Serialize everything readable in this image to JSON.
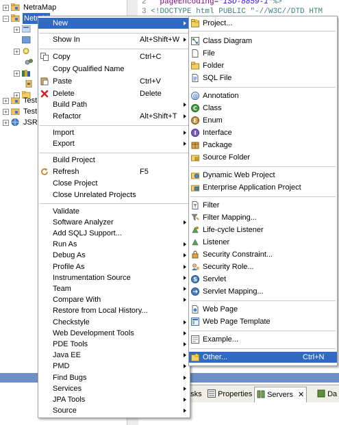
{
  "tree": {
    "items": [
      {
        "label": "NetraMap"
      },
      {
        "label": "NetraM"
      },
      {
        "label": "Test"
      },
      {
        "label": "Test"
      },
      {
        "label": "JSR"
      }
    ]
  },
  "editor": {
    "line2_num": "2",
    "line2_attr": "pageEncoding",
    "line2_eq": "=",
    "line2_str": "\"ISO-8859-1\"",
    "line2_end": "%>",
    "line3_num": "3",
    "line3_text": "<!DOCTYPE html PUBLIC \"-//W3C//DTD HTM"
  },
  "views": {
    "tabs": [
      {
        "label": "asks"
      },
      {
        "label": "Properties"
      },
      {
        "label": "Servers",
        "active": true
      },
      {
        "label": "Da"
      }
    ]
  },
  "context_menu": {
    "items": [
      {
        "label": "New",
        "submenu": true,
        "highlighted": true
      },
      {
        "label": "Show In",
        "shortcut": "Alt+Shift+W",
        "submenu": true
      },
      {
        "label": "Copy",
        "shortcut": "Ctrl+C",
        "icon": "copy-icon"
      },
      {
        "label": "Copy Qualified Name"
      },
      {
        "label": "Paste",
        "shortcut": "Ctrl+V",
        "icon": "paste-icon"
      },
      {
        "label": "Delete",
        "shortcut": "Delete",
        "icon": "delete-icon"
      },
      {
        "label": "Build Path",
        "submenu": true
      },
      {
        "label": "Refactor",
        "shortcut": "Alt+Shift+T",
        "submenu": true
      },
      {
        "label": "Import",
        "submenu": true
      },
      {
        "label": "Export",
        "submenu": true
      },
      {
        "label": "Build Project"
      },
      {
        "label": "Refresh",
        "shortcut": "F5",
        "icon": "refresh-icon"
      },
      {
        "label": "Close Project"
      },
      {
        "label": "Close Unrelated Projects"
      },
      {
        "label": "Validate"
      },
      {
        "label": "Software Analyzer",
        "submenu": true
      },
      {
        "label": "Add SQLJ Support..."
      },
      {
        "label": "Run As",
        "submenu": true
      },
      {
        "label": "Debug As",
        "submenu": true
      },
      {
        "label": "Profile As",
        "submenu": true
      },
      {
        "label": "Instrumentation Source",
        "submenu": true
      },
      {
        "label": "Team",
        "submenu": true
      },
      {
        "label": "Compare With",
        "submenu": true
      },
      {
        "label": "Restore from Local History..."
      },
      {
        "label": "Checkstyle",
        "submenu": true
      },
      {
        "label": "Web Development Tools",
        "submenu": true
      },
      {
        "label": "PDE Tools",
        "submenu": true
      },
      {
        "label": "Java EE",
        "submenu": true
      },
      {
        "label": "PMD",
        "submenu": true
      },
      {
        "label": "Find Bugs",
        "submenu": true
      },
      {
        "label": "Services",
        "submenu": true
      },
      {
        "label": "JPA Tools",
        "submenu": true
      },
      {
        "label": "Source",
        "submenu": true
      }
    ]
  },
  "submenu_new": {
    "items": [
      {
        "label": "Project...",
        "icon": "project-icon"
      },
      {
        "label": "Class Diagram",
        "icon": "class-diagram-icon"
      },
      {
        "label": "File",
        "icon": "file-icon"
      },
      {
        "label": "Folder",
        "icon": "folder-icon"
      },
      {
        "label": "SQL File",
        "icon": "sql-file-icon"
      },
      {
        "label": "Annotation",
        "icon": "annotation-icon"
      },
      {
        "label": "Class",
        "icon": "class-icon"
      },
      {
        "label": "Enum",
        "icon": "enum-icon"
      },
      {
        "label": "Interface",
        "icon": "interface-icon"
      },
      {
        "label": "Package",
        "icon": "package-icon"
      },
      {
        "label": "Source Folder",
        "icon": "source-folder-icon"
      },
      {
        "label": "Dynamic Web Project",
        "icon": "web-project-icon"
      },
      {
        "label": "Enterprise Application Project",
        "icon": "ear-project-icon"
      },
      {
        "label": "Filter",
        "icon": "filter-icon"
      },
      {
        "label": "Filter Mapping...",
        "icon": "filter-mapping-icon"
      },
      {
        "label": "Life-cycle Listener",
        "icon": "lifecycle-listener-icon"
      },
      {
        "label": "Listener",
        "icon": "listener-icon"
      },
      {
        "label": "Security Constraint...",
        "icon": "security-constraint-icon"
      },
      {
        "label": "Security Role...",
        "icon": "security-role-icon"
      },
      {
        "label": "Servlet",
        "icon": "servlet-icon"
      },
      {
        "label": "Servlet Mapping...",
        "icon": "servlet-mapping-icon"
      },
      {
        "label": "Web Page",
        "icon": "web-page-icon"
      },
      {
        "label": "Web Page Template",
        "icon": "web-page-template-icon"
      },
      {
        "label": "Example...",
        "icon": "example-icon"
      },
      {
        "label": "Other...",
        "shortcut": "Ctrl+N",
        "icon": "other-icon",
        "highlighted": true
      }
    ]
  },
  "colors": {
    "highlight": "#316ac5",
    "menu_bg": "#ffffff",
    "separator": "#c5c5c5"
  }
}
